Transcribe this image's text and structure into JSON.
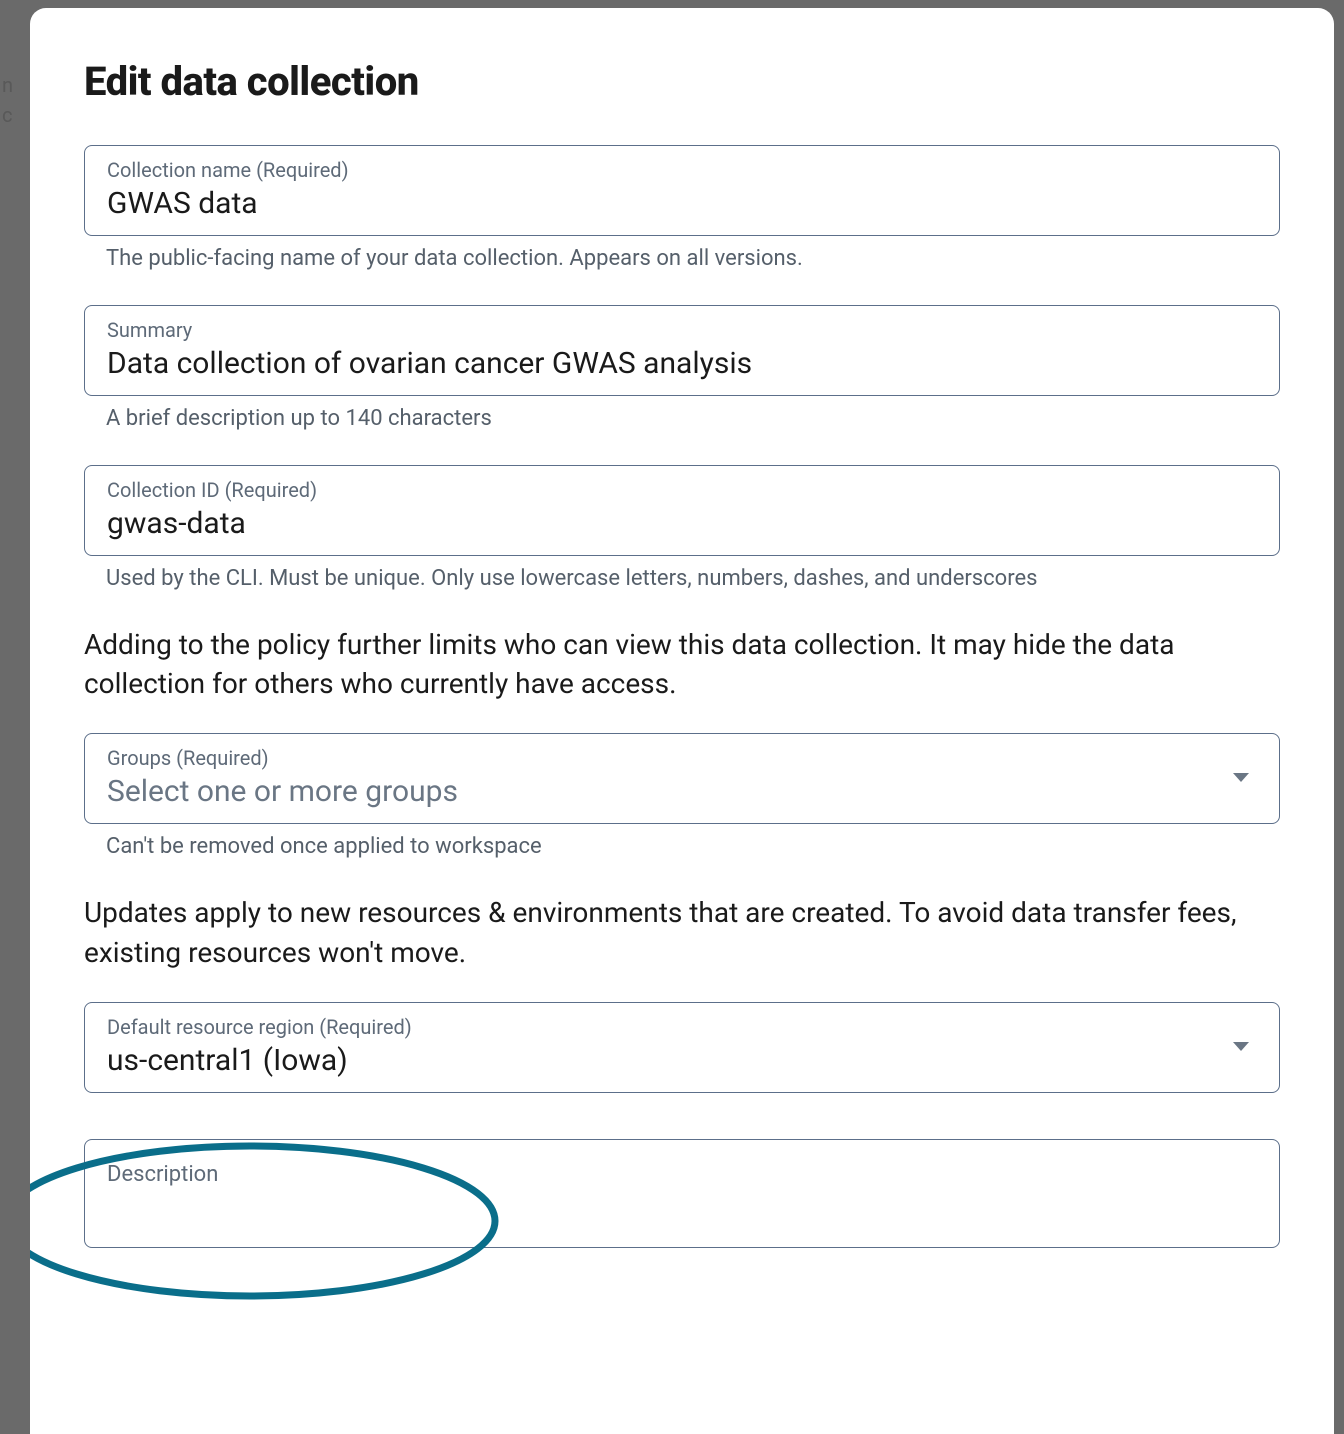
{
  "modal": {
    "title": "Edit data collection",
    "fields": {
      "collection_name": {
        "label": "Collection name (Required)",
        "value": "GWAS data",
        "helper": "The public-facing name of your data collection. Appears on all versions."
      },
      "summary": {
        "label": "Summary",
        "value": "Data collection of ovarian cancer GWAS analysis",
        "helper": "A brief description up to 140 characters"
      },
      "collection_id": {
        "label": "Collection ID (Required)",
        "value": "gwas-data",
        "helper": "Used by the CLI. Must be unique. Only use lowercase letters, numbers, dashes, and underscores"
      },
      "groups": {
        "label": "Groups (Required)",
        "placeholder": "Select one or more groups",
        "helper": "Can't be removed once applied to workspace"
      },
      "region": {
        "label": "Default resource region (Required)",
        "value": "us-central1 (Iowa)"
      },
      "description": {
        "label": "Description"
      }
    },
    "policy_text": "Adding to the policy further limits who can view this data collection. It may hide the data collection for others who currently have access.",
    "region_text": "Updates apply to new resources & environments that are created. To avoid data transfer fees, existing resources won't move."
  },
  "annotation": {
    "ellipse_color": "#0a6e8a"
  }
}
